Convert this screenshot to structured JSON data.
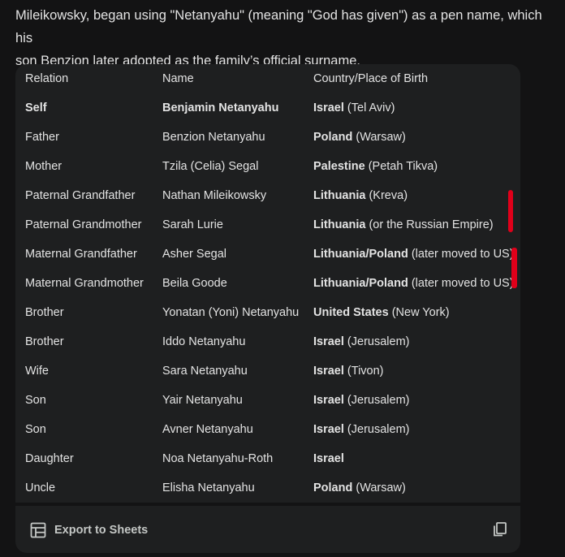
{
  "intro": {
    "line1": "Mileikowsky, began using \"Netanyahu\" (meaning \"God has given\") as a pen name, which his",
    "line2": "son Benzion later adopted as the family’s official surname."
  },
  "table": {
    "headers": [
      "Relation",
      "Name",
      "Country/Place of Birth"
    ],
    "rows": [
      {
        "relation": "Self",
        "name": "Benjamin Netanyahu",
        "country": "Israel",
        "place": " (Tel Aviv)",
        "bold_row": true
      },
      {
        "relation": "Father",
        "name": "Benzion Netanyahu",
        "country": "Poland",
        "place": " (Warsaw)"
      },
      {
        "relation": "Mother",
        "name": "Tzila (Celia) Segal",
        "country": "Palestine",
        "place": " (Petah Tikva)"
      },
      {
        "relation": "Paternal Grandfather",
        "name": "Nathan Mileikowsky",
        "country": "Lithuania",
        "place": " (Kreva)"
      },
      {
        "relation": "Paternal Grandmother",
        "name": "Sarah Lurie",
        "country": "Lithuania",
        "place": " (or the Russian Empire)"
      },
      {
        "relation": "Maternal Grandfather",
        "name": "Asher Segal",
        "country": "Lithuania/Poland",
        "place": " (later moved to US)"
      },
      {
        "relation": "Maternal Grandmother",
        "name": "Beila Goode",
        "country": "Lithuania/Poland",
        "place": " (later moved to US)"
      },
      {
        "relation": "Brother",
        "name": "Yonatan (Yoni) Netanyahu",
        "country": "United States",
        "place": " (New York)"
      },
      {
        "relation": "Brother",
        "name": "Iddo Netanyahu",
        "country": "Israel",
        "place": " (Jerusalem)"
      },
      {
        "relation": "Wife",
        "name": "Sara Netanyahu",
        "country": "Israel",
        "place": " (Tivon)"
      },
      {
        "relation": "Son",
        "name": "Yair Netanyahu",
        "country": "Israel",
        "place": " (Jerusalem)"
      },
      {
        "relation": "Son",
        "name": "Avner Netanyahu",
        "country": "Israel",
        "place": " (Jerusalem)"
      },
      {
        "relation": "Daughter",
        "name": "Noa Netanyahu-Roth",
        "country": "Israel",
        "place": ""
      },
      {
        "relation": "Uncle",
        "name": "Elisha Netanyahu",
        "country": "Poland",
        "place": " (Warsaw)"
      }
    ]
  },
  "footer": {
    "export_label": "Export to Sheets",
    "export_icon": "table-icon",
    "copy_icon": "copy-icon"
  },
  "colors": {
    "background": "#131314",
    "card": "#1e1f20",
    "text": "#e3e3e3",
    "annotation_red": "#e0001a"
  }
}
